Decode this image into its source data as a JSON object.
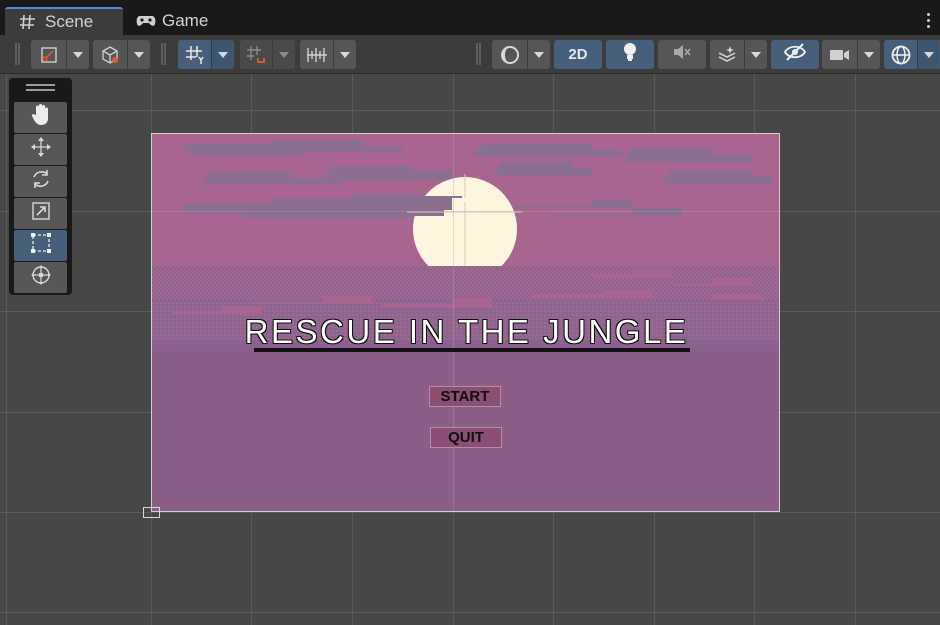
{
  "tabs": [
    {
      "label": "Scene",
      "icon": "grid-hash-icon",
      "active": true
    },
    {
      "label": "Game",
      "icon": "gamepad-icon",
      "active": false
    }
  ],
  "toolbar": {
    "btn_2d_label": "2D",
    "accent_color": "#46607c"
  },
  "tools": [
    {
      "name": "hand-tool",
      "icon": "hand-icon",
      "active": false
    },
    {
      "name": "move-tool",
      "icon": "move-arrows-icon",
      "active": false
    },
    {
      "name": "rotate-tool",
      "icon": "rotate-icon",
      "active": false
    },
    {
      "name": "scale-tool",
      "icon": "scale-icon",
      "active": false
    },
    {
      "name": "rect-tool",
      "icon": "rect-transform-icon",
      "active": true
    },
    {
      "name": "transform-tool",
      "icon": "transform-icon",
      "active": false
    }
  ],
  "game": {
    "title": "RESCUE IN THE JUNGLE",
    "start_label": "START",
    "quit_label": "QUIT",
    "sky_color": "#a8668e",
    "ground_color": "#8b5f86",
    "moon_color": "#fdf5e0",
    "cloud_color": "#8a6f8f",
    "button_color": "#8b4f74"
  }
}
